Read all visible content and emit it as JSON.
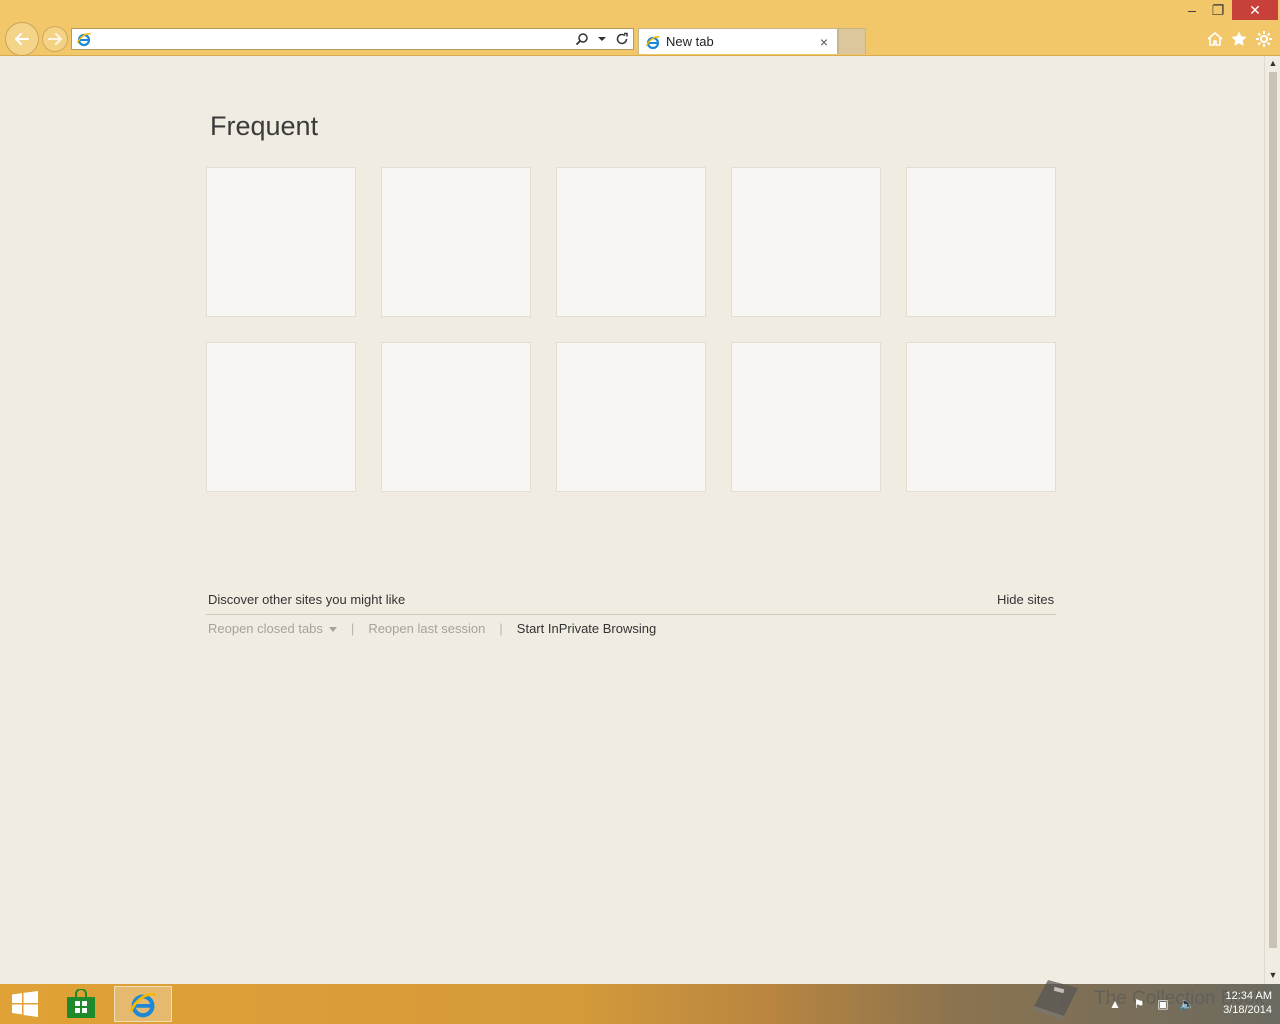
{
  "browser": {
    "address_value": "",
    "tab_label": "New tab",
    "close_tab_glyph": "×"
  },
  "window_controls": {
    "minimize": "–",
    "maximize": "❐",
    "close": "✕"
  },
  "page": {
    "title": "Frequent",
    "tiles_count": 10,
    "discover_label": "Discover other sites you might like",
    "hide_sites_label": "Hide sites",
    "links": {
      "reopen_closed_tabs": "Reopen closed tabs",
      "separator": "|",
      "reopen_last_session": "Reopen last session",
      "start_inprivate": "Start InPrivate Browsing"
    }
  },
  "taskbar": {
    "clock_time": "12:34 AM",
    "clock_date": "3/18/2014",
    "watermark": "The Collection Book"
  },
  "colors": {
    "chrome": "#f2c76a",
    "page_bg": "#f1ece2",
    "tile_bg": "#f7f6f3",
    "close_red": "#c7413a"
  },
  "icons": [
    "back-arrow-icon",
    "forward-arrow-icon",
    "ie-logo-icon",
    "search-icon",
    "refresh-icon",
    "home-icon",
    "star-icon",
    "gear-icon",
    "windows-logo-icon",
    "store-icon"
  ]
}
